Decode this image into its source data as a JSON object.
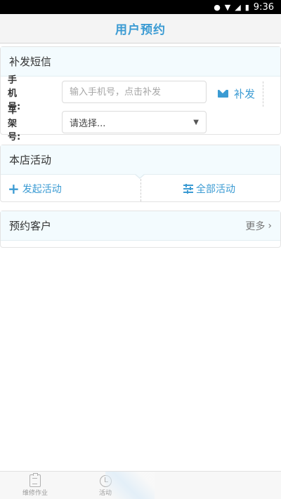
{
  "status_bar": {
    "time": "9:36",
    "icons": [
      "location-icon",
      "wifi-icon",
      "signal-icon",
      "battery-icon"
    ]
  },
  "header": {
    "title": "用户预约"
  },
  "sms_card": {
    "title": "补发短信",
    "phone_label": "手机号:",
    "phone_value": "",
    "phone_placeholder": "输入手机号，点击补发",
    "frame_label": "车架号:",
    "frame_selected": "请选择...",
    "resend_label": "补发"
  },
  "activity_card": {
    "title": "本店活动",
    "start_label": "发起活动",
    "all_label": "全部活动"
  },
  "customer_card": {
    "title": "预约客户",
    "more_label": "更多"
  },
  "bottom_nav": {
    "items": [
      {
        "label": "维修作业",
        "icon": "clipboard-icon"
      },
      {
        "label": "活动",
        "icon": "timer-icon"
      }
    ]
  },
  "colors": {
    "accent": "#3b9bd3",
    "header_bg": "#f3fbfe",
    "title_bar_bg": "#f4f4f4"
  }
}
